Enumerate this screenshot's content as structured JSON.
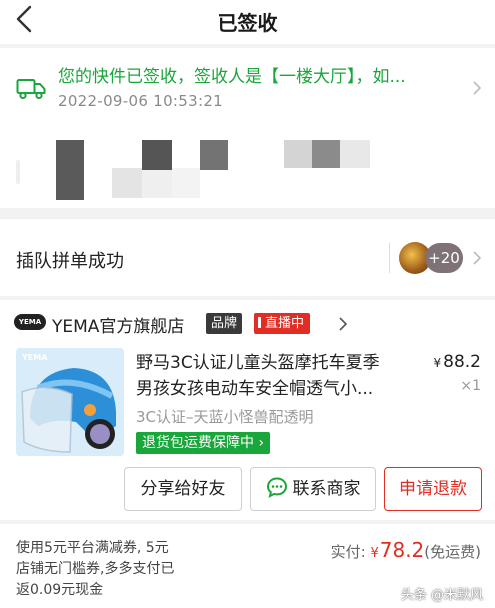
{
  "header": {
    "title": "已签收",
    "back_icon": "chevron-left-icon"
  },
  "logistics": {
    "icon": "truck-icon",
    "status_text": "您的快件已签收，签收人是【一楼大厅】，如...",
    "time": "2022-09-06 10:53:21",
    "accent_color": "#19a63a"
  },
  "group_buy": {
    "label": "插队拼单成功",
    "count_badge": "+20"
  },
  "store": {
    "logo_text": "YEMA",
    "name": "YEMA官方旗舰店",
    "brand_tag": "品牌",
    "live_tag": "直播中",
    "live_color": "#e02e24"
  },
  "product": {
    "title_line1": "野马3C认证儿童头盔摩托车夏季",
    "title_line2": "男孩女孩电动车安全帽透气小...",
    "price_symbol": "¥",
    "price": "88.2",
    "quantity": "×1",
    "spec": "3C认证–天蓝小怪兽配透明",
    "guarantee": "退货包运费保障中 ›"
  },
  "actions": {
    "share": "分享给好友",
    "contact": "联系商家",
    "refund": "申请退款"
  },
  "payment": {
    "promo_line1": "使用5元平台满减券, 5元",
    "promo_line2": "店铺无门槛券,多多支付已",
    "promo_line3": "返0.09元现金",
    "paid_label": "实付:",
    "currency": "¥",
    "amount": "78.2",
    "shipping_note": "(免运费)"
  },
  "watermark": "头条 @米默风"
}
